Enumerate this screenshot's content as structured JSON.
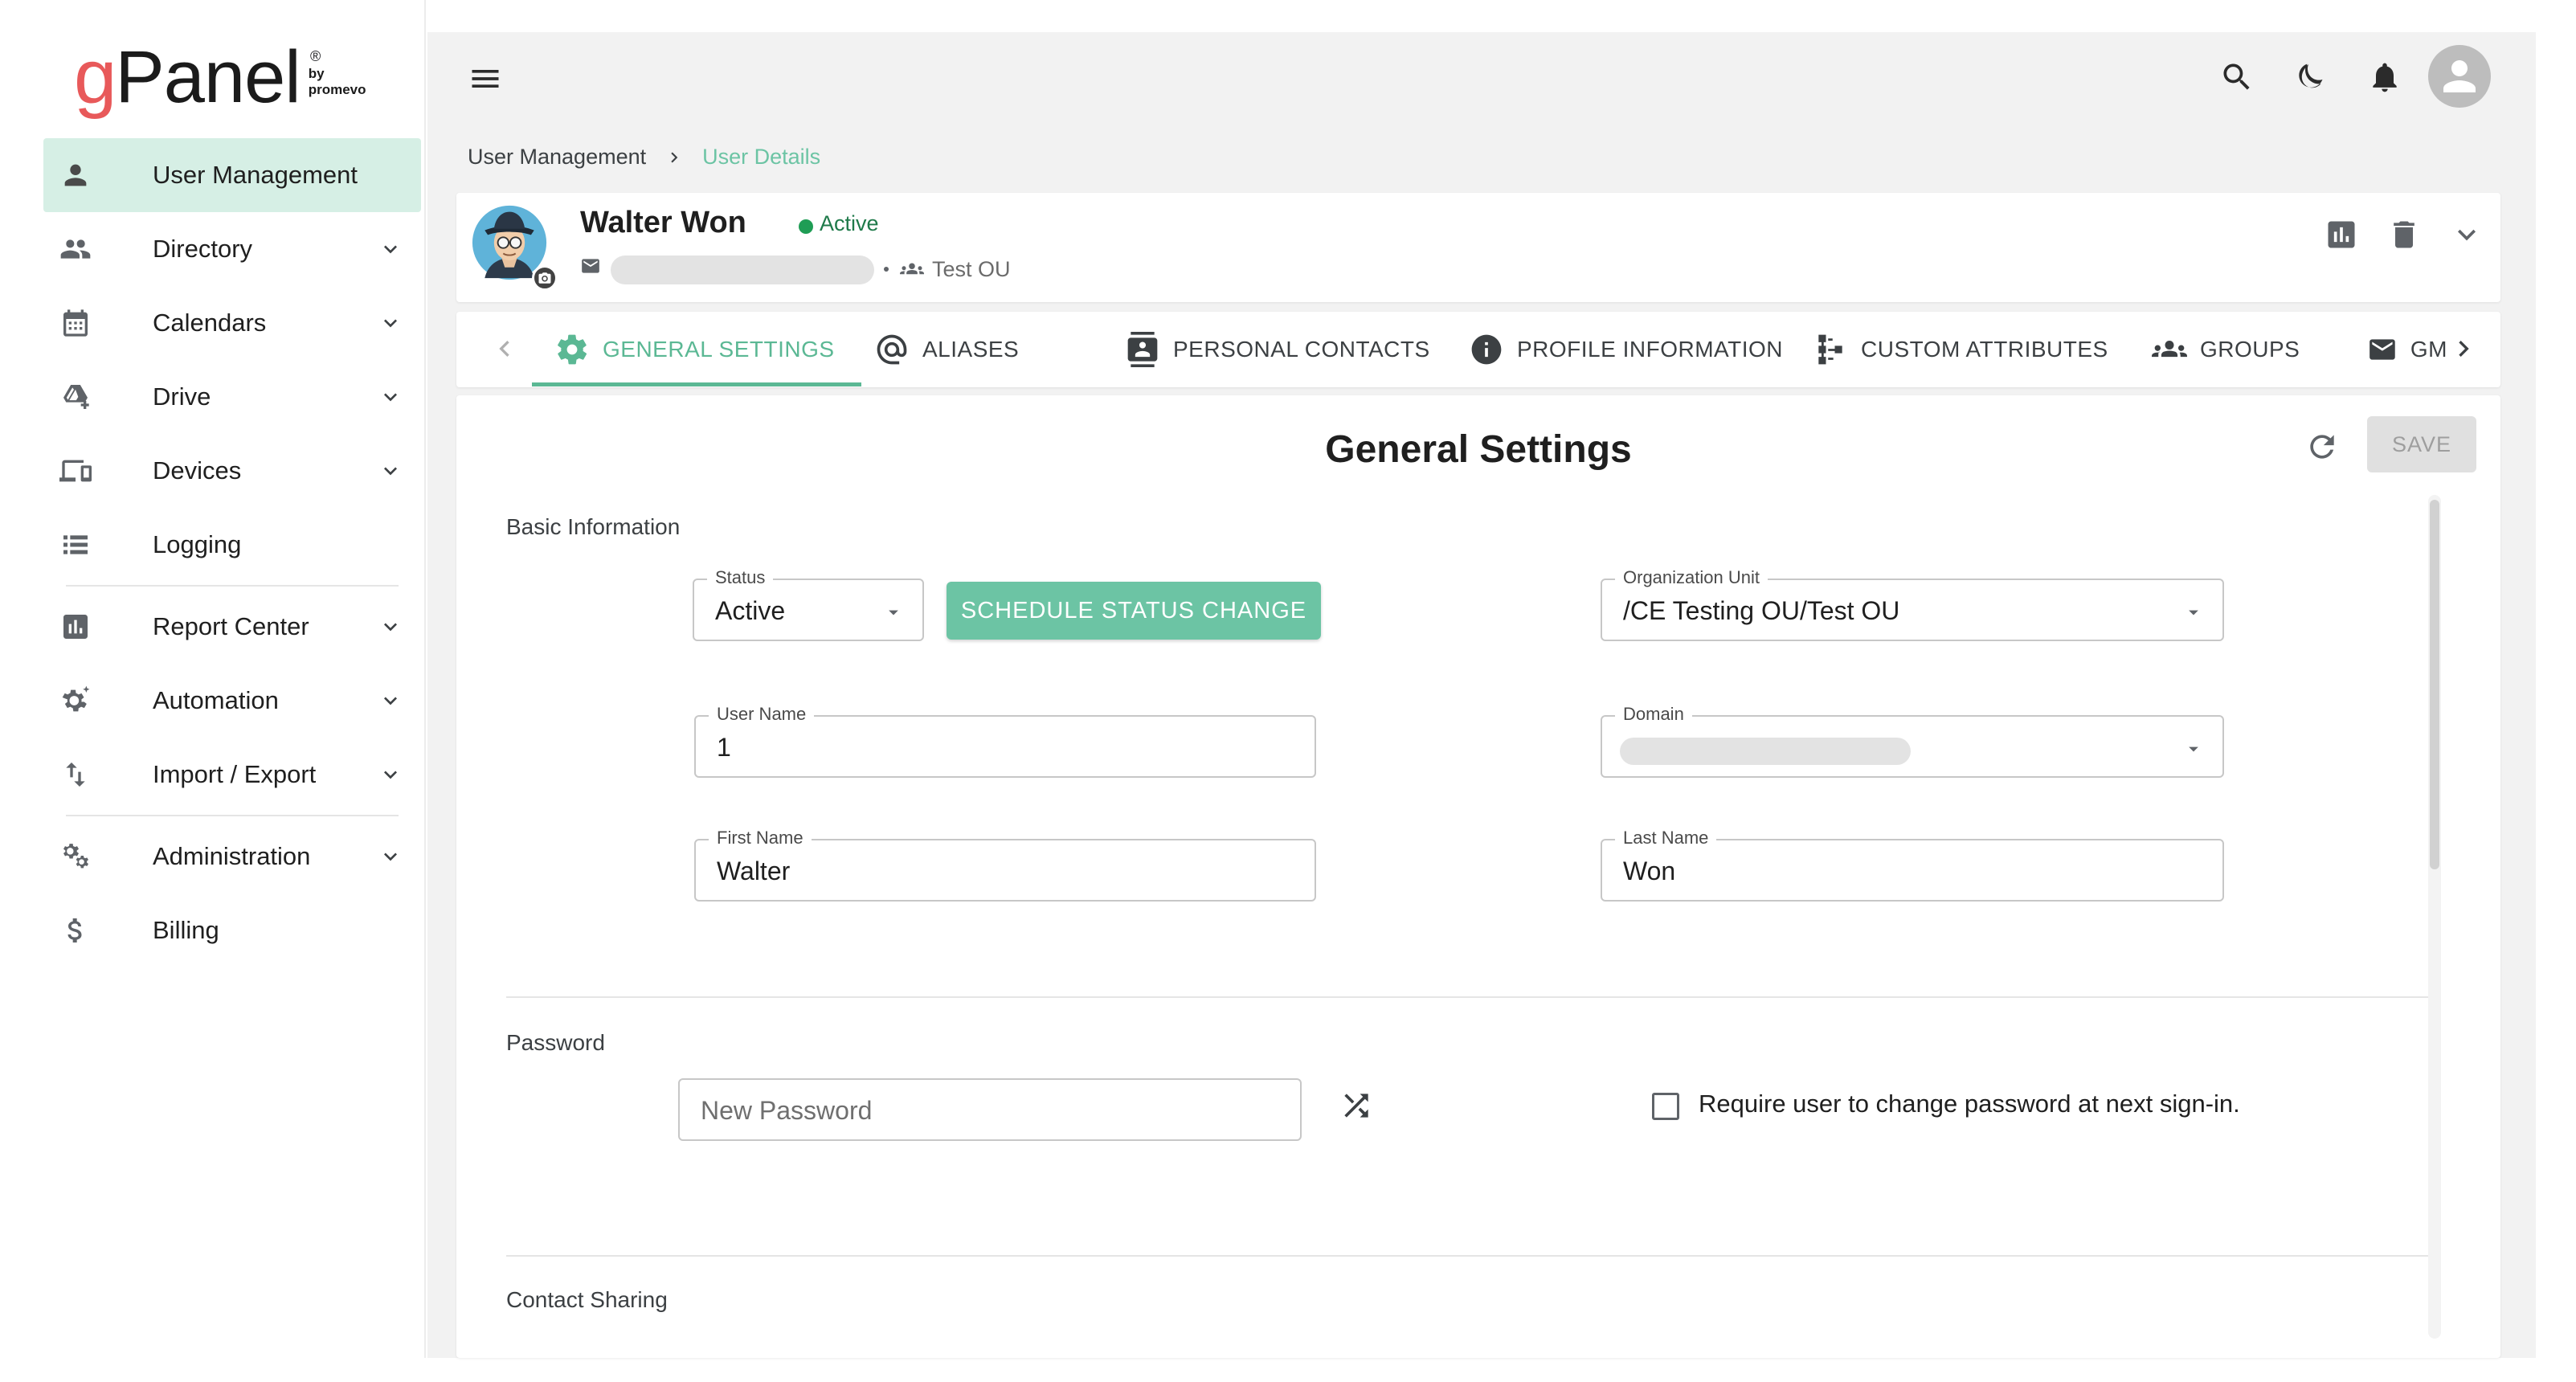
{
  "brand": {
    "logo_g": "g",
    "logo_panel": "Panel",
    "logo_by": "by",
    "logo_promevo": "promevo",
    "reg_mark": "®"
  },
  "sidebar": {
    "items": [
      {
        "label": "User Management",
        "icon": "person-icon",
        "active": true,
        "expandable": false
      },
      {
        "label": "Directory",
        "icon": "people-icon",
        "expandable": true
      },
      {
        "label": "Calendars",
        "icon": "calendar-icon",
        "expandable": true
      },
      {
        "label": "Drive",
        "icon": "drive-icon",
        "expandable": true
      },
      {
        "label": "Devices",
        "icon": "devices-icon",
        "expandable": true
      },
      {
        "label": "Logging",
        "icon": "list-icon",
        "expandable": false
      },
      {
        "label": "Report Center",
        "icon": "chart-icon",
        "expandable": true
      },
      {
        "label": "Automation",
        "icon": "gear-sparkle-icon",
        "expandable": true
      },
      {
        "label": "Import / Export",
        "icon": "swap-vert-icon",
        "expandable": true
      },
      {
        "label": "Administration",
        "icon": "gears-icon",
        "expandable": true
      },
      {
        "label": "Billing",
        "icon": "dollar-icon",
        "expandable": false
      }
    ]
  },
  "topbar": {
    "icons": [
      "menu-icon",
      "search-icon",
      "dark-mode-icon",
      "bell-icon",
      "account-avatar-icon"
    ]
  },
  "breadcrumb": {
    "parent": "User Management",
    "current": "User Details"
  },
  "user": {
    "name": "Walter Won",
    "status": "Active",
    "ou": "Test OU",
    "status_color": "#1f9d55"
  },
  "tabs": [
    {
      "label": "GENERAL SETTINGS",
      "icon": "gear-icon",
      "active": true
    },
    {
      "label": "ALIASES",
      "icon": "at-icon"
    },
    {
      "label": "PERSONAL CONTACTS",
      "icon": "contacts-icon"
    },
    {
      "label": "PROFILE INFORMATION",
      "icon": "info-icon"
    },
    {
      "label": "CUSTOM ATTRIBUTES",
      "icon": "hierarchy-icon"
    },
    {
      "label": "GROUPS",
      "icon": "groups-icon"
    },
    {
      "label": "GM",
      "icon": "mail-icon"
    }
  ],
  "panel": {
    "title": "General Settings",
    "save_label": "SAVE",
    "basic_info_label": "Basic Information",
    "status_field": {
      "label": "Status",
      "value": "Active"
    },
    "schedule_label": "SCHEDULE STATUS CHANGE",
    "org_unit_field": {
      "label": "Organization Unit",
      "value": "/CE Testing OU/Test OU"
    },
    "username_field": {
      "label": "User Name",
      "value": "1"
    },
    "domain_field": {
      "label": "Domain"
    },
    "first_name_field": {
      "label": "First Name",
      "value": "Walter"
    },
    "last_name_field": {
      "label": "Last Name",
      "value": "Won"
    },
    "password_label": "Password",
    "new_password_placeholder": "New Password",
    "require_change_label": "Require user to change password at next sign-in.",
    "contact_sharing_label": "Contact Sharing"
  },
  "colors": {
    "accent": "#6cc4a4",
    "active_nav_bg": "#d6efe5",
    "brand_red": "#e8595a"
  }
}
